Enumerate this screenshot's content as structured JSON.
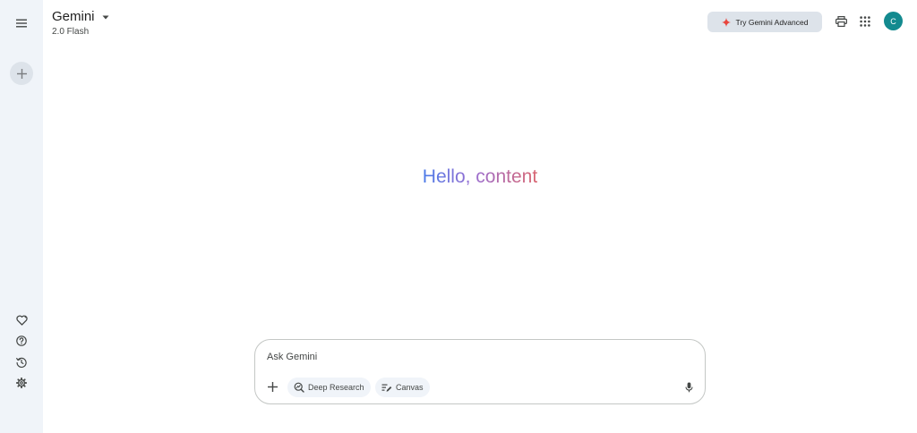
{
  "header": {
    "app_title": "Gemini",
    "model_name": "2.0 Flash",
    "upgrade_label": "Try Gemini Advanced",
    "avatar_initial": "C"
  },
  "main": {
    "greeting": "Hello, content"
  },
  "composer": {
    "placeholder": "Ask Gemini",
    "tools": [
      {
        "label": "Deep Research",
        "icon": "deep-research-icon"
      },
      {
        "label": "Canvas",
        "icon": "canvas-icon"
      }
    ]
  },
  "sidebar": {
    "icons": [
      "menu-icon",
      "plus-icon",
      "gem-heart-icon",
      "help-icon",
      "history-icon",
      "settings-icon"
    ]
  },
  "colors": {
    "sidebar_bg": "#f0f4f9",
    "avatar_bg": "#138a8f",
    "greeting_blue": "#4b7be8",
    "greeting_red": "#d96570",
    "sparkle_red": "#e8453c"
  }
}
